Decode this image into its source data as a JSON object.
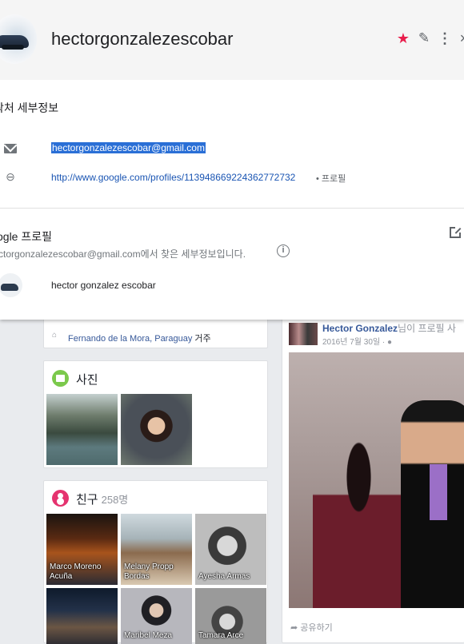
{
  "contact": {
    "name": "hectorgonzalezescobar",
    "section_title": "락처 세부정보",
    "email": "hectorgonzalezescobar@gmail.com",
    "profile_url": "http://www.google.com/profiles/113948669224362772732",
    "profile_url_suffix": "• 프로필"
  },
  "header_icons": {
    "star": "★",
    "edit": "✎",
    "more": "⋮",
    "close": "×"
  },
  "google_profile": {
    "title": "ogle 프로필",
    "source_note": "ctorgonzalezescobar@gmail.com에서 찾은 세부정보입니다.",
    "display_name": "hector gonzalez escobar"
  },
  "facebook": {
    "location": {
      "place": "Fernando de la Mora, Paraguay",
      "suffix": " 거주"
    },
    "photos": {
      "title": "사진"
    },
    "friends": {
      "title": "친구",
      "count": "258명",
      "items": [
        {
          "label": "Marco Moreno Acuña"
        },
        {
          "label": "Melany Propp Bordas"
        },
        {
          "label": "Ayesha Armas"
        },
        {
          "label": ""
        },
        {
          "label": "Maribel Meza"
        },
        {
          "label": "Tamara Arce"
        }
      ]
    },
    "post": {
      "author": "Hector Gonzalez",
      "author_rest": "님이 프로필 사",
      "date": "2016년 7월 30일 · ",
      "share_label": "공유하기"
    }
  },
  "colors": {
    "star": "#e91e4c",
    "selection": "#2a6fd6",
    "link": "#1a55b3",
    "fb_link": "#365899"
  }
}
